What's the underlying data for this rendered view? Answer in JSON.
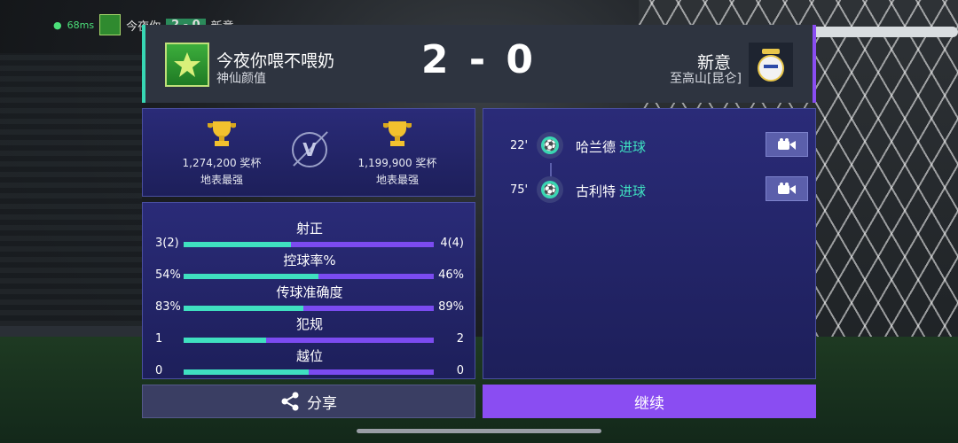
{
  "hud": {
    "ping": "68ms",
    "home_short": "今夜你",
    "score": "2 - 0",
    "away_short": "新意"
  },
  "header": {
    "home": {
      "name": "今夜你喂不喂奶",
      "subtitle": "神仙颜值"
    },
    "score": "2 - 0",
    "away": {
      "name": "新意",
      "subtitle": "至高山[昆仑]"
    }
  },
  "trophies": {
    "home": {
      "count": "1,274,200 奖杯",
      "label": "地表最强"
    },
    "vs": "V",
    "away": {
      "count": "1,199,900 奖杯",
      "label": "地表最强"
    }
  },
  "stats": [
    {
      "title": "射正",
      "left": "3(2)",
      "right": "4(4)",
      "left_fraction": 0.43
    },
    {
      "title": "控球率%",
      "left": "54%",
      "right": "46%",
      "left_fraction": 0.54
    },
    {
      "title": "传球准确度",
      "left": "83%",
      "right": "89%",
      "left_fraction": 0.48
    },
    {
      "title": "犯规",
      "left": "1",
      "right": "2",
      "left_fraction": 0.33
    },
    {
      "title": "越位",
      "left": "0",
      "right": "0",
      "left_fraction": 0.5
    }
  ],
  "events": [
    {
      "minute": "22'",
      "player": "哈兰德",
      "type": "进球"
    },
    {
      "minute": "75'",
      "player": "古利特",
      "type": "进球"
    }
  ],
  "buttons": {
    "share": "分享",
    "continue": "继续"
  },
  "colors": {
    "home_accent": "#3fe0c0",
    "away_accent": "#7b4bf0",
    "continue_bg": "#8a4df2"
  }
}
